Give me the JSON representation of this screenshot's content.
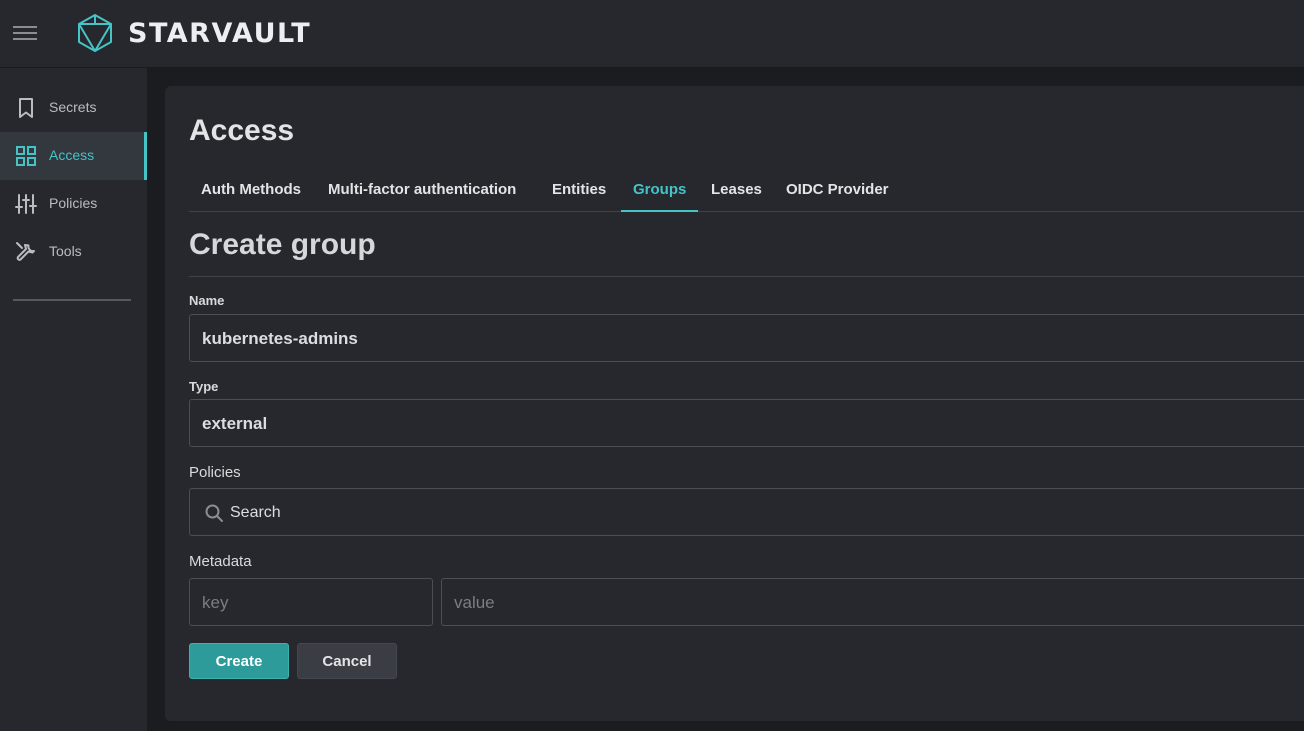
{
  "header": {
    "brand": "STARVAULT",
    "menu_icon": "hamburger-icon",
    "logo_icon": "cube-logo-icon"
  },
  "sidebar": {
    "items": [
      {
        "label": "Secrets",
        "icon": "bookmark-icon"
      },
      {
        "label": "Access",
        "icon": "grid-icon",
        "active": true
      },
      {
        "label": "Policies",
        "icon": "sliders-icon"
      },
      {
        "label": "Tools",
        "icon": "wrench-icon"
      }
    ]
  },
  "page": {
    "title": "Access"
  },
  "tabs": [
    {
      "label": "Auth Methods"
    },
    {
      "label": "Multi-factor authentication"
    },
    {
      "label": "Entities"
    },
    {
      "label": "Groups",
      "active": true
    },
    {
      "label": "Leases"
    },
    {
      "label": "OIDC Provider"
    }
  ],
  "form": {
    "title": "Create group",
    "name": {
      "label": "Name",
      "value": "kubernetes-admins"
    },
    "type": {
      "label": "Type",
      "value": "external"
    },
    "policies": {
      "label": "Policies",
      "search_placeholder": "Search"
    },
    "metadata": {
      "label": "Metadata",
      "key_placeholder": "key",
      "value_placeholder": "value"
    },
    "create_label": "Create",
    "cancel_label": "Cancel"
  },
  "colors": {
    "accent": "#45c3c7",
    "button": "#2d9b9a",
    "background": "#1a1c20",
    "panel": "#26282e"
  }
}
